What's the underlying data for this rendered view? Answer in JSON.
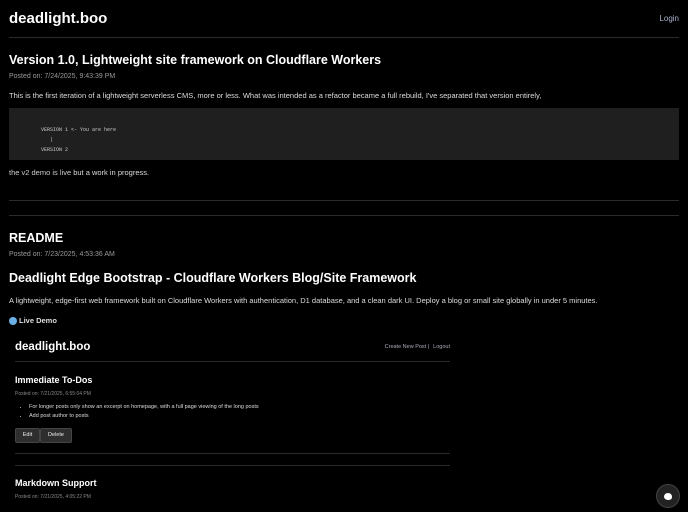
{
  "header": {
    "site_title": "deadlight.boo",
    "login_label": "Login"
  },
  "posts": [
    {
      "title": "Version 1.0, Lightweight site framework on Cloudflare Workers",
      "posted": "Posted on: 7/24/2025, 9:43:39 PM",
      "paragraph": "This is the first iteration of a lightweight serverless CMS, more or less. What was intended as a refactor became a full rebuild, I've separated that version entirely,",
      "code": "VERSION 1 <- You are here\n   |\nVERSION 2",
      "footer_link": "the v2 demo is live",
      "footer_rest": " but a work in progress."
    },
    {
      "title": "README",
      "posted": "Posted on: 7/23/2025, 4:53:36 AM",
      "heading": "Deadlight Edge Bootstrap - Cloudflare Workers Blog/Site Framework",
      "paragraph": "A lightweight, edge-first web framework built on Cloudflare Workers with authentication, D1 database, and a clean dark UI. Deploy a blog or small site globally in under 5 minutes.",
      "live_demo": "Live Demo"
    }
  ],
  "screenshot": {
    "site_title": "deadlight.boo",
    "nav_create": "Create New Post |",
    "nav_logout": "Logout",
    "post1": {
      "title": "Immediate To-Dos",
      "posted": "Posted on: 7/21/2025, 6:55:04 PM",
      "items": [
        "For longer posts only show an excerpt on homepage, with a full page viewing of the long posts",
        "Add post author to posts"
      ],
      "edit": "Edit",
      "delete": "Delete"
    },
    "post2": {
      "title": "Markdown Support",
      "posted": "Posted on: 7/21/2025, 4:05:22 PM"
    }
  },
  "theme_button": {
    "icon": "palette-icon"
  }
}
